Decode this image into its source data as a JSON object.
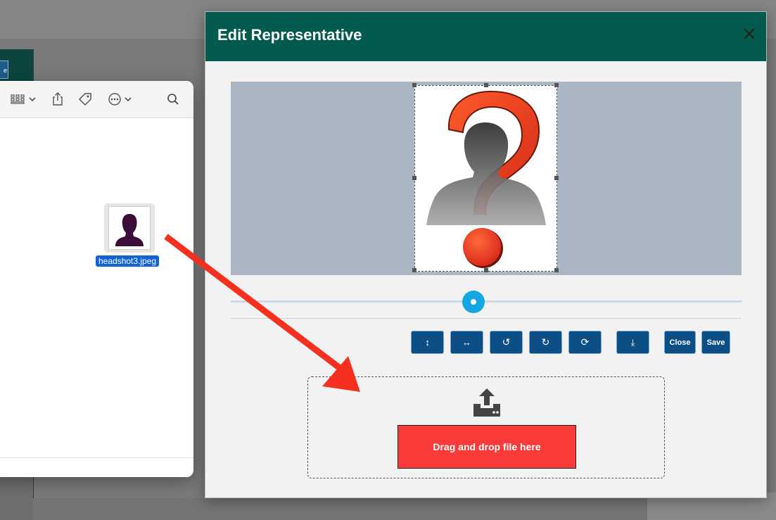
{
  "background": {
    "left_button_label": "e"
  },
  "finder": {
    "toolbar_icons": [
      "view-grid-icon",
      "chevron-down-icon",
      "share-icon",
      "tag-icon",
      "more-icon",
      "chevron-down-icon",
      "search-icon"
    ],
    "file": {
      "name": "headshot3.jpeg",
      "selected": true
    }
  },
  "modal": {
    "title": "Edit Representative",
    "close_icon": "close-icon",
    "crop_image": "question-mark-silhouette-placeholder",
    "zoom_slider": {
      "value": 0.5
    },
    "tools": [
      {
        "name": "flip-vertical-button",
        "icon": "arrows-vertical-icon",
        "glyph": "↕"
      },
      {
        "name": "flip-horizontal-button",
        "icon": "arrows-horizontal-icon",
        "glyph": "↔"
      },
      {
        "name": "rotate-left-button",
        "icon": "rotate-left-icon",
        "glyph": "↺"
      },
      {
        "name": "rotate-right-button",
        "icon": "rotate-right-icon",
        "glyph": "↻"
      },
      {
        "name": "reset-button",
        "icon": "refresh-icon",
        "glyph": "⟳"
      },
      {
        "name": "download-button",
        "icon": "download-icon",
        "glyph": "⤓"
      }
    ],
    "close_label": "Close",
    "save_label": "Save",
    "dropzone": {
      "icon": "upload-icon",
      "label": "Drag and drop file here"
    }
  },
  "colors": {
    "header": "#035a4f",
    "button": "#0b4f86",
    "slider": "#12a7e2",
    "drop_button": "#fb3a3a",
    "annotation_arrow": "#f5301f",
    "file_selection": "#1163d6"
  }
}
